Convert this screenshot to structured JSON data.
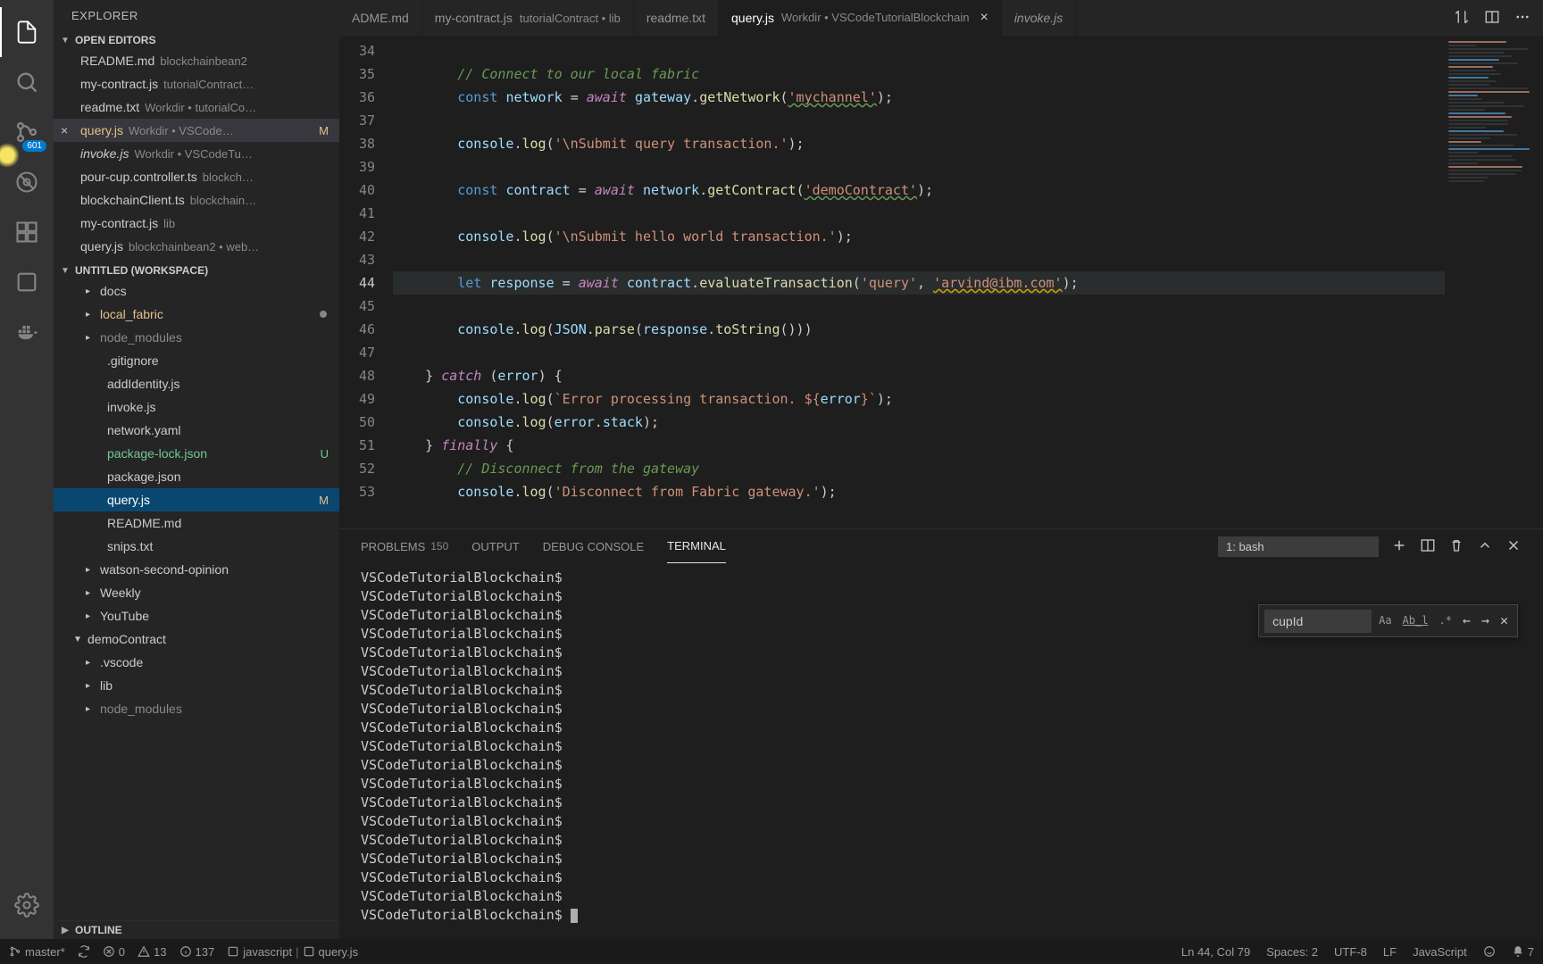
{
  "sidebar": {
    "title": "EXPLORER",
    "scmBadge": "601",
    "openEditorsHeader": "OPEN EDITORS",
    "workspaceHeader": "UNTITLED (WORKSPACE)",
    "outlineHeader": "OUTLINE",
    "openEditors": [
      {
        "name": "README.md",
        "path": "blockchainbean2",
        "active": false,
        "italic": false
      },
      {
        "name": "my-contract.js",
        "path": "tutorialContract…",
        "active": false,
        "italic": false
      },
      {
        "name": "readme.txt",
        "path": "Workdir • tutorialCo…",
        "active": false,
        "italic": false
      },
      {
        "name": "query.js",
        "path": "Workdir • VSCode…",
        "active": true,
        "italic": false,
        "mod": true,
        "letter": "M"
      },
      {
        "name": "invoke.js",
        "path": "Workdir • VSCodeTu…",
        "active": false,
        "italic": true
      },
      {
        "name": "pour-cup.controller.ts",
        "path": "blockch…",
        "active": false,
        "italic": false
      },
      {
        "name": "blockchainClient.ts",
        "path": "blockchain…",
        "active": false,
        "italic": false
      },
      {
        "name": "my-contract.js",
        "path": "lib",
        "active": false,
        "italic": false
      },
      {
        "name": "query.js",
        "path": "blockchainbean2 • web…",
        "active": false,
        "italic": false
      }
    ],
    "tree": [
      {
        "t": "folder",
        "d": 1,
        "name": "docs",
        "open": false
      },
      {
        "t": "folder",
        "d": 1,
        "name": "local_fabric",
        "open": false,
        "mod": true,
        "dot": true
      },
      {
        "t": "folder",
        "d": 1,
        "name": "node_modules",
        "open": false,
        "dim": true
      },
      {
        "t": "file",
        "d": 2,
        "name": ".gitignore"
      },
      {
        "t": "file",
        "d": 2,
        "name": "addIdentity.js"
      },
      {
        "t": "file",
        "d": 2,
        "name": "invoke.js"
      },
      {
        "t": "file",
        "d": 2,
        "name": "network.yaml"
      },
      {
        "t": "file",
        "d": 2,
        "name": "package-lock.json",
        "u": true,
        "letter": "U"
      },
      {
        "t": "file",
        "d": 2,
        "name": "package.json"
      },
      {
        "t": "file",
        "d": 2,
        "name": "query.js",
        "mod": true,
        "letter": "M",
        "sel": true
      },
      {
        "t": "file",
        "d": 2,
        "name": "README.md"
      },
      {
        "t": "file",
        "d": 2,
        "name": "snips.txt"
      },
      {
        "t": "folder",
        "d": 1,
        "name": "watson-second-opinion",
        "open": false,
        "arrow": "sub"
      },
      {
        "t": "folder",
        "d": 1,
        "name": "Weekly",
        "open": false,
        "arrow": "sub"
      },
      {
        "t": "folder",
        "d": 1,
        "name": "YouTube",
        "open": false,
        "arrow": "sub"
      },
      {
        "t": "folder",
        "d": 0,
        "name": "demoContract",
        "open": true
      },
      {
        "t": "folder",
        "d": 1,
        "name": ".vscode",
        "open": false
      },
      {
        "t": "folder",
        "d": 1,
        "name": "lib",
        "open": false
      },
      {
        "t": "folder",
        "d": 1,
        "name": "node_modules",
        "open": false,
        "dim": true
      }
    ]
  },
  "tabs": [
    {
      "label": "ADME.md",
      "path": "",
      "partial": true
    },
    {
      "label": "my-contract.js",
      "path": "tutorialContract • lib"
    },
    {
      "label": "readme.txt",
      "path": ""
    },
    {
      "label": "query.js",
      "path": "Workdir • VSCodeTutorialBlockchain",
      "active": true,
      "closable": true
    },
    {
      "label": "invoke.js",
      "path": "",
      "italic": true
    }
  ],
  "code": {
    "startLine": 34,
    "currentLine": 44,
    "lines": [
      {
        "n": 34,
        "html": ""
      },
      {
        "n": 35,
        "html": "        <span class='cm'>// Connect to our local fabric</span>"
      },
      {
        "n": 36,
        "html": "        <span class='kw'>const</span> <span class='va'>network</span> <span class='op'>=</span> <span class='kw2'>await</span> <span class='va'>gateway</span>.<span class='fn'>getNetwork</span>(<span class='st wavy'>'mychannel'</span>);"
      },
      {
        "n": 37,
        "html": ""
      },
      {
        "n": 38,
        "html": "        <span class='va'>console</span>.<span class='fn'>log</span>(<span class='st'>'\\nSubmit query transaction.'</span>);"
      },
      {
        "n": 39,
        "html": ""
      },
      {
        "n": 40,
        "html": "        <span class='kw'>const</span> <span class='va'>contract</span> <span class='op'>=</span> <span class='kw2'>await</span> <span class='va'>network</span>.<span class='fn'>getContract</span>(<span class='st wavy'>'demoContract'</span>);"
      },
      {
        "n": 41,
        "html": ""
      },
      {
        "n": 42,
        "html": "        <span class='va'>console</span>.<span class='fn'>log</span>(<span class='st'>'\\nSubmit hello world transaction.'</span>);"
      },
      {
        "n": 43,
        "html": ""
      },
      {
        "n": 44,
        "html": "        <span class='kw'>let</span> <span class='va'>response</span> <span class='op'>=</span> <span class='kw2'>await</span> <span class='va'>contract</span>.<span class='fn'>evaluateTransaction</span>(<span class='st'>'query'</span>, <span class='st wavy2'>'arvind@ibm.com'</span>);"
      },
      {
        "n": 45,
        "html": ""
      },
      {
        "n": 46,
        "html": "        <span class='va'>console</span>.<span class='fn'>log</span>(<span class='va'>JSON</span>.<span class='fn'>parse</span>(<span class='va'>response</span>.<span class='fn'>toString</span>()))"
      },
      {
        "n": 47,
        "html": ""
      },
      {
        "n": 48,
        "html": "    } <span class='kw2'>catch</span> (<span class='va'>error</span>) {"
      },
      {
        "n": 49,
        "html": "        <span class='va'>console</span>.<span class='fn'>log</span>(<span class='st'>`Error processing transaction. ${</span><span class='va'>error</span><span class='st'>}`</span>);"
      },
      {
        "n": 50,
        "html": "        <span class='va'>console</span>.<span class='fn'>log</span>(<span class='va'>error</span>.<span class='va'>stack</span>);"
      },
      {
        "n": 51,
        "html": "    } <span class='kw2'>finally</span> {"
      },
      {
        "n": 52,
        "html": "        <span class='cm'>// Disconnect from the gateway</span>"
      },
      {
        "n": 53,
        "html": "        <span class='va'>console</span>.<span class='fn'>log</span>(<span class='st'>'Disconnect from Fabric gateway.'</span>);"
      }
    ]
  },
  "panel": {
    "tabs": {
      "problems": "PROBLEMS",
      "problemsCount": "150",
      "output": "OUTPUT",
      "debug": "DEBUG CONSOLE",
      "terminal": "TERMINAL"
    },
    "terminalSelect": "1: bash",
    "find": {
      "value": "cupId",
      "case": "Aa",
      "word": "Ab̲l",
      "regex": ".*"
    },
    "prompt": "VSCodeTutorialBlockchain$",
    "promptRepeat": 19
  },
  "status": {
    "branch": "master*",
    "sync": "",
    "errors": "0",
    "warnings": "13",
    "info": "137",
    "lang1": "javascript",
    "file": "query.js",
    "pos": "Ln 44, Col 79",
    "spaces": "Spaces: 2",
    "enc": "UTF-8",
    "eol": "LF",
    "lang2": "JavaScript",
    "bell": "7"
  }
}
